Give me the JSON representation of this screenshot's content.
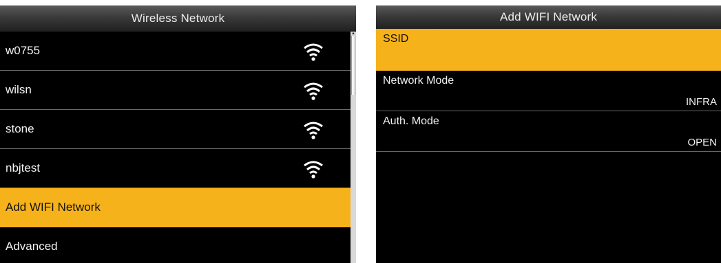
{
  "left_screen": {
    "title": "Wireless Network",
    "networks": [
      {
        "ssid": "w0755",
        "icon": "wifi-signal-icon"
      },
      {
        "ssid": "wilsn",
        "icon": "wifi-signal-icon"
      },
      {
        "ssid": "stone",
        "icon": "wifi-signal-icon"
      },
      {
        "ssid": "nbjtest",
        "icon": "wifi-signal-icon"
      }
    ],
    "add_network_label": "Add WIFI Network",
    "advanced_label": "Advanced"
  },
  "right_screen": {
    "title": "Add WIFI Network",
    "fields": [
      {
        "name": "SSID",
        "value": ""
      },
      {
        "name": "Network Mode",
        "value": "INFRA"
      },
      {
        "name": "Auth. Mode",
        "value": "OPEN"
      }
    ]
  },
  "colors": {
    "background": "#000000",
    "selection": "#f6b21a",
    "text": "#f2f2f2",
    "divider": "#6a6a6a"
  }
}
